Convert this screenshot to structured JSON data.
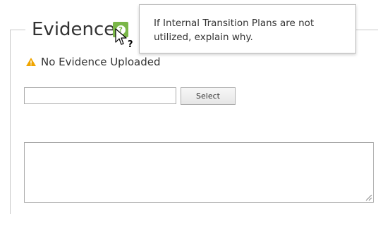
{
  "evidence": {
    "legend_title": "Evidence",
    "help_icon": "question-mark-icon",
    "tooltip_text": "If Internal Transition Plans are not utilized, explain why.",
    "status_icon": "warning-triangle-icon",
    "status_text": "No Evidence Uploaded",
    "file_input_value": "",
    "select_button_label": "Select",
    "explanation_value": ""
  },
  "colors": {
    "help_button": "#7ab648",
    "warning": "#f0a500",
    "border": "#aaaaaa",
    "text": "#333333"
  }
}
